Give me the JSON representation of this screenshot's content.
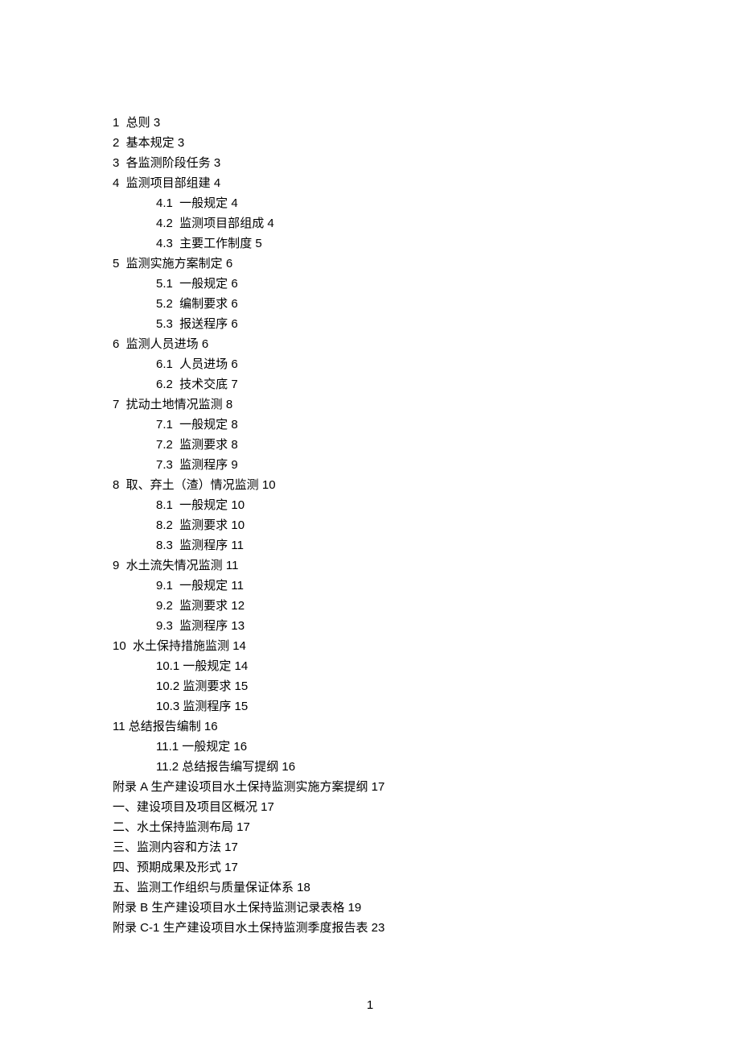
{
  "toc": [
    {
      "level": 1,
      "text": "1  总则 3"
    },
    {
      "level": 1,
      "text": "2  基本规定 3"
    },
    {
      "level": 1,
      "text": "3  各监测阶段任务 3"
    },
    {
      "level": 1,
      "text": "4  监测项目部组建 4"
    },
    {
      "level": 2,
      "text": "4.1  一般规定 4"
    },
    {
      "level": 2,
      "text": "4.2  监测项目部组成 4"
    },
    {
      "level": 2,
      "text": "4.3  主要工作制度 5"
    },
    {
      "level": 1,
      "text": "5  监测实施方案制定 6"
    },
    {
      "level": 2,
      "text": "5.1  一般规定 6"
    },
    {
      "level": 2,
      "text": "5.2  编制要求 6"
    },
    {
      "level": 2,
      "text": "5.3  报送程序 6"
    },
    {
      "level": 1,
      "text": "6  监测人员进场 6"
    },
    {
      "level": 2,
      "text": "6.1  人员进场 6"
    },
    {
      "level": 2,
      "text": "6.2  技术交底 7"
    },
    {
      "level": 1,
      "text": "7  扰动土地情况监测 8"
    },
    {
      "level": 2,
      "text": "7.1  一般规定 8"
    },
    {
      "level": 2,
      "text": "7.2  监测要求 8"
    },
    {
      "level": 2,
      "text": "7.3  监测程序 9"
    },
    {
      "level": 1,
      "text": "8  取、弃土（渣）情况监测 10"
    },
    {
      "level": 2,
      "text": "8.1  一般规定 10"
    },
    {
      "level": 2,
      "text": "8.2  监测要求 10"
    },
    {
      "level": 2,
      "text": "8.3  监测程序 11"
    },
    {
      "level": 1,
      "text": "9  水土流失情况监测 11"
    },
    {
      "level": 2,
      "text": "9.1  一般规定 11"
    },
    {
      "level": 2,
      "text": "9.2  监测要求 12"
    },
    {
      "level": 2,
      "text": "9.3  监测程序 13"
    },
    {
      "level": 1,
      "text": "10  水土保持措施监测 14"
    },
    {
      "level": 2,
      "text": "10.1 一般规定 14"
    },
    {
      "level": 2,
      "text": "10.2 监测要求 15"
    },
    {
      "level": 2,
      "text": "10.3 监测程序 15"
    },
    {
      "level": 1,
      "text": "11 总结报告编制 16"
    },
    {
      "level": 2,
      "text": "11.1 一般规定 16"
    },
    {
      "level": 2,
      "text": "11.2 总结报告编写提纲 16"
    },
    {
      "level": 1,
      "text": "附录 A 生产建设项目水土保持监测实施方案提纲 17"
    },
    {
      "level": 1,
      "text": "一、建设项目及项目区概况 17"
    },
    {
      "level": 1,
      "text": "二、水土保持监测布局 17"
    },
    {
      "level": 1,
      "text": "三、监测内容和方法 17"
    },
    {
      "level": 1,
      "text": "四、预期成果及形式 17"
    },
    {
      "level": 1,
      "text": "五、监测工作组织与质量保证体系 18"
    },
    {
      "level": 1,
      "text": "附录 B 生产建设项目水土保持监测记录表格 19"
    },
    {
      "level": 1,
      "text": "附录 C-1 生产建设项目水土保持监测季度报告表 23"
    }
  ],
  "page_number": "1"
}
